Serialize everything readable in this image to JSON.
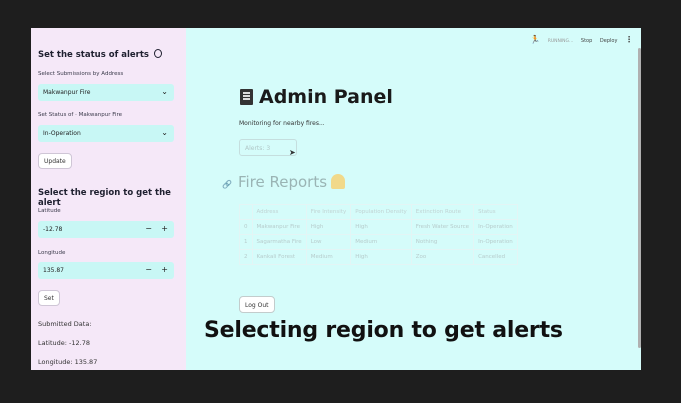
{
  "sidebar": {
    "status_title": "Set the status of alerts",
    "select_label": "Select Submissions by Address",
    "selected_address": "Makwanpur Fire",
    "status_label": "Set Status of · Makwanpur Fire",
    "selected_status": "In-Operation",
    "update_label": "Update",
    "region_title": "Select the region to get the alert",
    "latitude_label": "Latitude",
    "latitude_value": "-12.78",
    "longitude_label": "Longitude",
    "longitude_value": "135.87",
    "set_label": "Set",
    "submitted_label": "Submitted Data:",
    "submitted_latitude": "Latitude: -12.78",
    "submitted_longitude": "Longitude: 135.87"
  },
  "toolbar": {
    "running": "RUNNING...",
    "stop": "Stop",
    "deploy": "Deploy"
  },
  "main": {
    "title": "Admin Panel",
    "subtitle": "Monitoring for nearby fires...",
    "alerts": "Alerts: 3",
    "reports_title": "Fire Reports",
    "logout_label": "Log Out"
  },
  "table": {
    "headers": [
      "",
      "Address",
      "Fire Intensity",
      "Population Density",
      "Extinction Route",
      "Status"
    ],
    "rows": [
      [
        "0",
        "Makwanpur Fire",
        "High",
        "High",
        "Fresh Water Source",
        "In-Operation"
      ],
      [
        "1",
        "Sagarmatha Fire",
        "Low",
        "Medium",
        "Nothing",
        "In-Operation"
      ],
      [
        "2",
        "Kankali Forest",
        "Medium",
        "High",
        "Zoo",
        "Cancelled"
      ]
    ]
  },
  "caption": "Selecting region to get alerts"
}
